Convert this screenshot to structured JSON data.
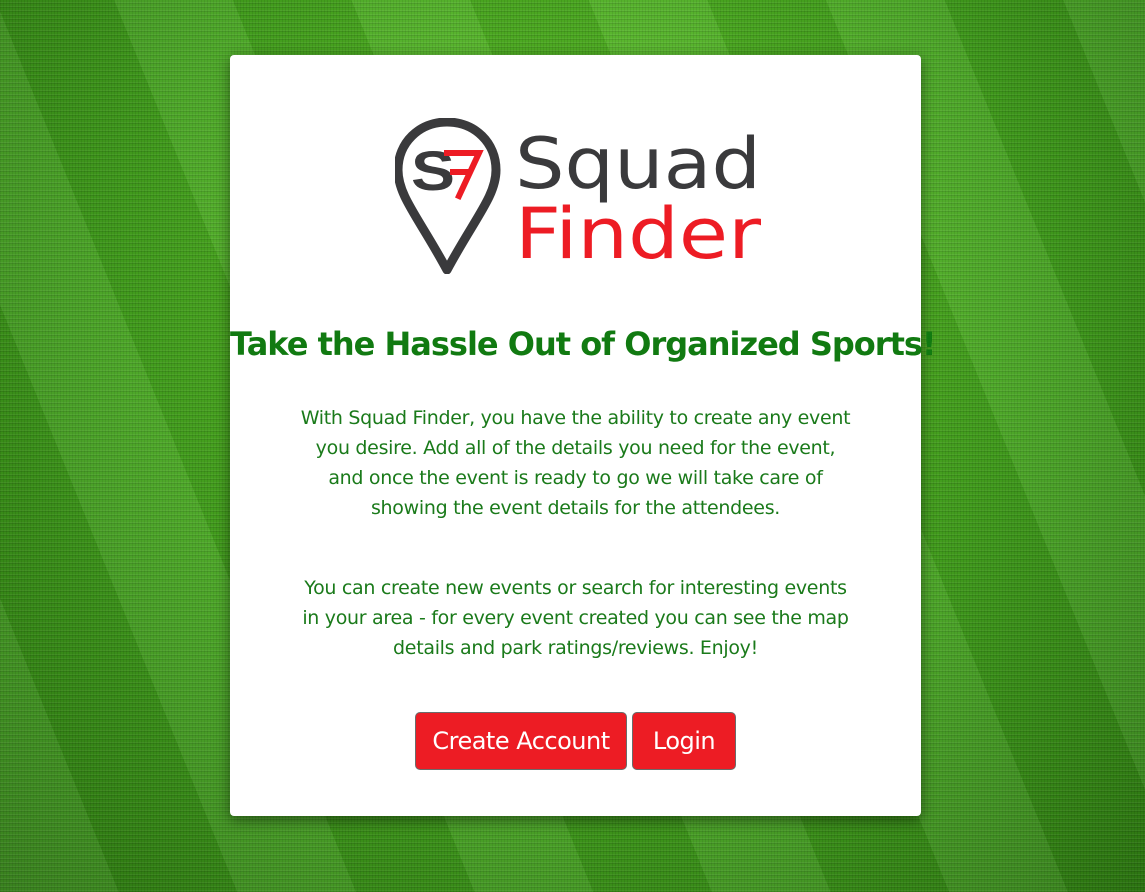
{
  "logo": {
    "initials": "SF",
    "line1": "Squad",
    "line2": "Finder",
    "colors": {
      "dark": "#3a3a3c",
      "red": "#ed1c24"
    }
  },
  "hero": {
    "headline": "Take the Hassle Out of Organized Sports!",
    "paragraph1": "With Squad Finder, you have the ability to create any event you desire. Add all of the details you need for the event, and once the event is ready to go we will take care of showing the event details for the attendees.",
    "paragraph2": "You can create new events or search for interesting events in your area - for every event created you can see the map details and park ratings/reviews. Enjoy!"
  },
  "actions": {
    "create_account_label": "Create Account",
    "login_label": "Login"
  },
  "theme": {
    "text_green": "#117a11",
    "button_red": "#ed1c24",
    "background": "grass"
  }
}
